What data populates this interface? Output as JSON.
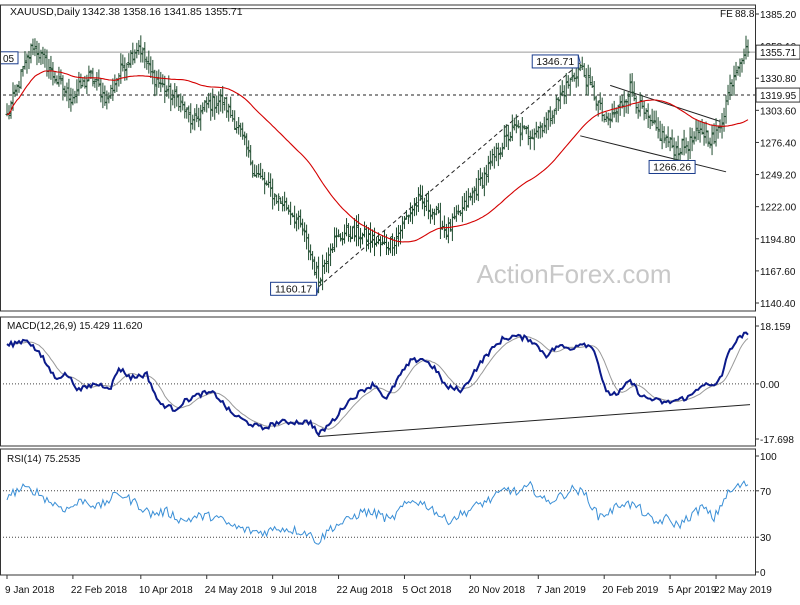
{
  "chart_data": {
    "type": "line",
    "header": {
      "symbol": "XAUUSD,Daily",
      "ohlc": "1342.38 1358.16 1341.85 1355.71",
      "fe_label": "FE",
      "fe_value": "88.8",
      "left_label": "05"
    },
    "watermark": "ActionForex.com",
    "x_ticks": [
      "9 Jan 2018",
      "22 Feb 2018",
      "10 Apr 2018",
      "24 May 2018",
      "9 Jul 2018",
      "22 Aug 2018",
      "5 Oct 2018",
      "20 Nov 2018",
      "7 Jan 2019",
      "20 Feb 2019",
      "5 Apr 2019",
      "22 May 2019"
    ],
    "price_panel": {
      "ylim": [
        1140.0,
        1395.0
      ],
      "y_ticks": [
        "1385.20",
        "1358.10",
        "1330.80",
        "1303.60",
        "1276.40",
        "1249.20",
        "1222.00",
        "1194.80",
        "1167.60",
        "1140.40"
      ],
      "current_price_label": "1355.71",
      "level_label": "1319.95",
      "level_value": 1319.95,
      "current_value": 1355.71,
      "fe_value_num": 1392.0,
      "annotations": [
        {
          "text": "1346.71",
          "bar": 287,
          "value": 1346.71
        },
        {
          "text": "1160.17",
          "bar": 156,
          "value": 1160.17
        },
        {
          "text": "1266.26",
          "bar": 335,
          "value": 1266.26
        }
      ],
      "anchors": [
        [
          0,
          1302
        ],
        [
          8,
          1340
        ],
        [
          13,
          1362
        ],
        [
          25,
          1332
        ],
        [
          32,
          1318
        ],
        [
          42,
          1336
        ],
        [
          50,
          1316
        ],
        [
          58,
          1344
        ],
        [
          66,
          1362
        ],
        [
          72,
          1338
        ],
        [
          82,
          1320
        ],
        [
          86,
          1316
        ],
        [
          93,
          1296
        ],
        [
          100,
          1312
        ],
        [
          108,
          1316
        ],
        [
          116,
          1292
        ],
        [
          124,
          1256
        ],
        [
          134,
          1236
        ],
        [
          142,
          1224
        ],
        [
          148,
          1208
        ],
        [
          156,
          1166
        ],
        [
          162,
          1196
        ],
        [
          170,
          1206
        ],
        [
          180,
          1202
        ],
        [
          188,
          1194
        ],
        [
          194,
          1199
        ],
        [
          200,
          1218
        ],
        [
          206,
          1232
        ],
        [
          214,
          1222
        ],
        [
          220,
          1206
        ],
        [
          228,
          1224
        ],
        [
          238,
          1250
        ],
        [
          246,
          1274
        ],
        [
          254,
          1292
        ],
        [
          262,
          1288
        ],
        [
          270,
          1298
        ],
        [
          278,
          1322
        ],
        [
          284,
          1336
        ],
        [
          287,
          1344
        ],
        [
          294,
          1320
        ],
        [
          300,
          1296
        ],
        [
          306,
          1308
        ],
        [
          312,
          1326
        ],
        [
          316,
          1312
        ],
        [
          322,
          1296
        ],
        [
          328,
          1286
        ],
        [
          335,
          1274
        ],
        [
          342,
          1280
        ],
        [
          348,
          1290
        ],
        [
          354,
          1282
        ],
        [
          358,
          1300
        ],
        [
          362,
          1328
        ],
        [
          366,
          1348
        ],
        [
          369,
          1356
        ]
      ],
      "trendlines": [
        {
          "from": [
            156,
            1160.17
          ],
          "to": [
            287,
            1346.71
          ],
          "style": "dashed"
        },
        {
          "from": [
            302,
            1328
          ],
          "to": [
            357,
            1298
          ],
          "style": "solid"
        },
        {
          "from": [
            287,
            1286
          ],
          "to": [
            360,
            1256
          ],
          "style": "solid"
        }
      ]
    },
    "macd_panel": {
      "label": "MACD(12,26,9) 15.429 11.620",
      "ylim": [
        -19.5,
        21.0
      ],
      "y_ticks": [
        "18.159",
        "0.00",
        "-17.698"
      ],
      "zero_value": 0.0,
      "anchors": [
        [
          0,
          12
        ],
        [
          10,
          14
        ],
        [
          18,
          8
        ],
        [
          24,
          2
        ],
        [
          30,
          3
        ],
        [
          36,
          -2
        ],
        [
          44,
          0
        ],
        [
          52,
          -1
        ],
        [
          56,
          5
        ],
        [
          62,
          2
        ],
        [
          70,
          3
        ],
        [
          76,
          -6
        ],
        [
          84,
          -8
        ],
        [
          90,
          -5
        ],
        [
          98,
          -3
        ],
        [
          104,
          -3
        ],
        [
          112,
          -9
        ],
        [
          120,
          -12
        ],
        [
          128,
          -14
        ],
        [
          136,
          -12
        ],
        [
          146,
          -12
        ],
        [
          152,
          -12
        ],
        [
          156,
          -16
        ],
        [
          164,
          -11
        ],
        [
          170,
          -6
        ],
        [
          178,
          -2
        ],
        [
          184,
          0
        ],
        [
          190,
          -5
        ],
        [
          196,
          2
        ],
        [
          202,
          7
        ],
        [
          208,
          8
        ],
        [
          214,
          5
        ],
        [
          220,
          -1
        ],
        [
          228,
          -2
        ],
        [
          234,
          4
        ],
        [
          240,
          9
        ],
        [
          248,
          14
        ],
        [
          254,
          15
        ],
        [
          262,
          14
        ],
        [
          270,
          9
        ],
        [
          276,
          12
        ],
        [
          282,
          11
        ],
        [
          288,
          13
        ],
        [
          294,
          11
        ],
        [
          300,
          -3
        ],
        [
          306,
          -3
        ],
        [
          312,
          1
        ],
        [
          318,
          -4
        ],
        [
          324,
          -5
        ],
        [
          330,
          -6
        ],
        [
          336,
          -5
        ],
        [
          342,
          -4
        ],
        [
          348,
          0
        ],
        [
          354,
          -1
        ],
        [
          358,
          3
        ],
        [
          362,
          11
        ],
        [
          366,
          14
        ],
        [
          369,
          15.43
        ]
      ],
      "trendline": {
        "from": [
          156,
          -16.5
        ],
        "to": [
          372,
          -6.5
        ]
      }
    },
    "rsi_panel": {
      "label": "RSI(14) 75.2535",
      "ylim": [
        0,
        100
      ],
      "y_ticks": [
        "100",
        "70",
        "30",
        "0"
      ],
      "levels": [
        70,
        30
      ],
      "anchors": [
        [
          0,
          66
        ],
        [
          8,
          72
        ],
        [
          14,
          70
        ],
        [
          22,
          60
        ],
        [
          30,
          54
        ],
        [
          38,
          62
        ],
        [
          46,
          56
        ],
        [
          56,
          68
        ],
        [
          64,
          60
        ],
        [
          72,
          50
        ],
        [
          80,
          52
        ],
        [
          88,
          44
        ],
        [
          96,
          48
        ],
        [
          104,
          48
        ],
        [
          112,
          40
        ],
        [
          120,
          36
        ],
        [
          128,
          34
        ],
        [
          136,
          38
        ],
        [
          144,
          36
        ],
        [
          150,
          34
        ],
        [
          156,
          26
        ],
        [
          162,
          38
        ],
        [
          170,
          44
        ],
        [
          178,
          52
        ],
        [
          186,
          50
        ],
        [
          192,
          44
        ],
        [
          198,
          56
        ],
        [
          204,
          62
        ],
        [
          212,
          56
        ],
        [
          220,
          44
        ],
        [
          228,
          50
        ],
        [
          236,
          58
        ],
        [
          244,
          64
        ],
        [
          250,
          72
        ],
        [
          256,
          68
        ],
        [
          262,
          74
        ],
        [
          270,
          60
        ],
        [
          278,
          66
        ],
        [
          284,
          72
        ],
        [
          290,
          66
        ],
        [
          296,
          48
        ],
        [
          302,
          52
        ],
        [
          308,
          60
        ],
        [
          316,
          56
        ],
        [
          324,
          42
        ],
        [
          330,
          46
        ],
        [
          336,
          40
        ],
        [
          342,
          48
        ],
        [
          348,
          56
        ],
        [
          354,
          46
        ],
        [
          360,
          66
        ],
        [
          366,
          74
        ],
        [
          369,
          75.25
        ]
      ]
    }
  }
}
